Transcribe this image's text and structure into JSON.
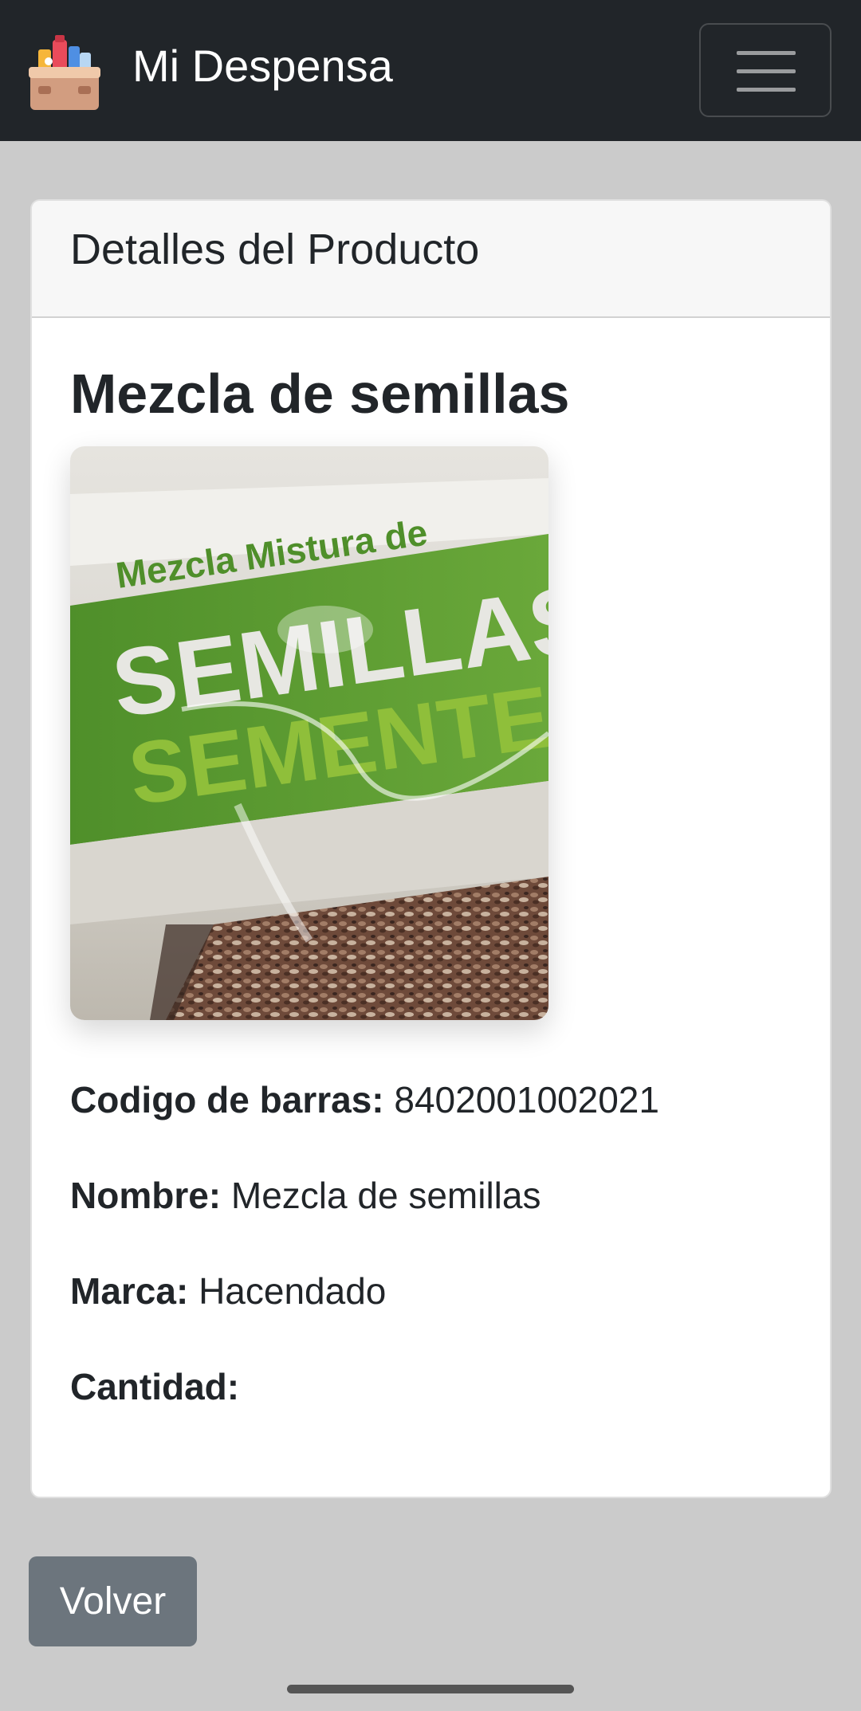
{
  "app": {
    "brand_name": "Mi Despensa",
    "logo_icon": "pantry-box-icon",
    "menu_icon": "hamburger-menu-icon"
  },
  "card": {
    "header_title": "Detalles del Producto"
  },
  "product": {
    "title": "Mezcla de semillas",
    "image": {
      "description_text_line1": "Mezcla Mistura de",
      "description_text_line2": "SEMILLAS",
      "description_text_line3": "SEMENTES"
    },
    "fields": [
      {
        "label": "Codigo de barras:",
        "value": "8402001002021"
      },
      {
        "label": "Nombre:",
        "value": "Mezcla de semillas"
      },
      {
        "label": "Marca:",
        "value": "Hacendado"
      },
      {
        "label": "Cantidad:",
        "value": ""
      }
    ]
  },
  "actions": {
    "back_label": "Volver"
  },
  "colors": {
    "navbar": "#212529",
    "page_background": "#cbcbcb",
    "button_secondary": "#6c757d",
    "package_green": "#5a9a2e"
  }
}
